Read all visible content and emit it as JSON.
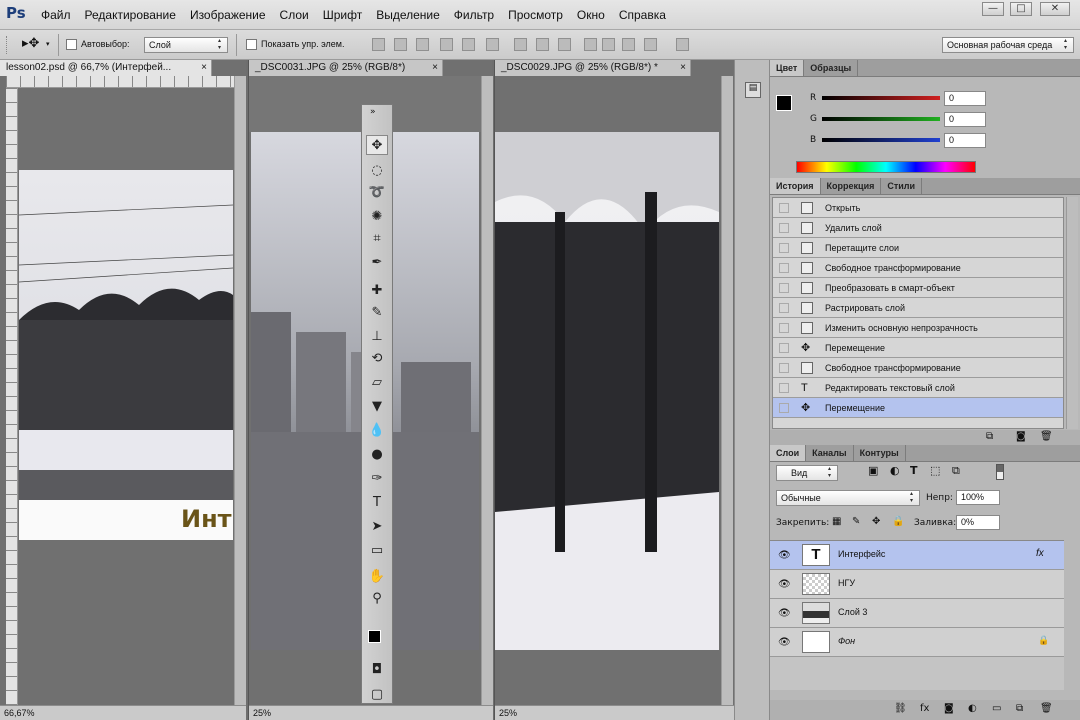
{
  "app": {
    "logo": "Ps"
  },
  "menu": [
    "Файл",
    "Редактирование",
    "Изображение",
    "Слои",
    "Шрифт",
    "Выделение",
    "Фильтр",
    "Просмотр",
    "Окно",
    "Справка"
  ],
  "window_controls": {
    "minimize": "—",
    "maximize": "□",
    "close": "✕"
  },
  "options": {
    "auto_select_label": "Автовыбор:",
    "auto_select_value": "Слой",
    "show_controls_label": "Показать упр. элем.",
    "workspace": "Основная рабочая среда"
  },
  "documents": [
    {
      "tab": "lesson02.psd @ 66,7% (Интерфей...",
      "zoom": "66,67%",
      "overlay_text": "Инт"
    },
    {
      "tab": "_DSC0031.JPG @ 25% (RGB/8*)",
      "zoom": "25%"
    },
    {
      "tab": "_DSC0029.JPG @ 25% (RGB/8*) *",
      "zoom": "25%"
    }
  ],
  "toolbox": {
    "collapse": "»"
  },
  "color_panel": {
    "tabs": [
      "Цвет",
      "Образцы"
    ],
    "channels": [
      {
        "name": "R",
        "value": "0",
        "color": "#d02020"
      },
      {
        "name": "G",
        "value": "0",
        "color": "#20b020"
      },
      {
        "name": "B",
        "value": "0",
        "color": "#2040d0"
      }
    ]
  },
  "history_panel": {
    "tabs": [
      "История",
      "Коррекция",
      "Стили"
    ],
    "items": [
      {
        "label": "Открыть",
        "icon": "document-icon"
      },
      {
        "label": "Удалить слой",
        "icon": "document-icon"
      },
      {
        "label": "Перетащите слои",
        "icon": "document-icon"
      },
      {
        "label": "Свободное трансформирование",
        "icon": "document-icon"
      },
      {
        "label": "Преобразовать в смарт-объект",
        "icon": "document-icon"
      },
      {
        "label": "Растрировать слой",
        "icon": "document-icon"
      },
      {
        "label": "Изменить основную непрозрачность",
        "icon": "document-icon"
      },
      {
        "label": "Перемещение",
        "icon": "move-icon"
      },
      {
        "label": "Свободное трансформирование",
        "icon": "document-icon"
      },
      {
        "label": "Редактировать текстовый слой",
        "icon": "type-icon"
      },
      {
        "label": "Перемещение",
        "icon": "move-icon",
        "selected": true
      }
    ]
  },
  "layers_panel": {
    "tabs": [
      "Слои",
      "Каналы",
      "Контуры"
    ],
    "filter_kind": "Вид",
    "blend_mode": "Обычные",
    "opacity_label": "Непр:",
    "opacity": "100%",
    "lock_label": "Закрепить:",
    "fill_label": "Заливка:",
    "fill": "0%",
    "layers": [
      {
        "name": "Интерфейс",
        "type": "text",
        "selected": true,
        "fx": "fx"
      },
      {
        "name": "НГУ",
        "type": "transparent"
      },
      {
        "name": "Слой 3",
        "type": "photo"
      },
      {
        "name": "Фон",
        "type": "background",
        "locked": true
      }
    ]
  },
  "colors": {
    "accent_selected": "#b4c3ee",
    "panel_bg": "#b8b8b8"
  }
}
